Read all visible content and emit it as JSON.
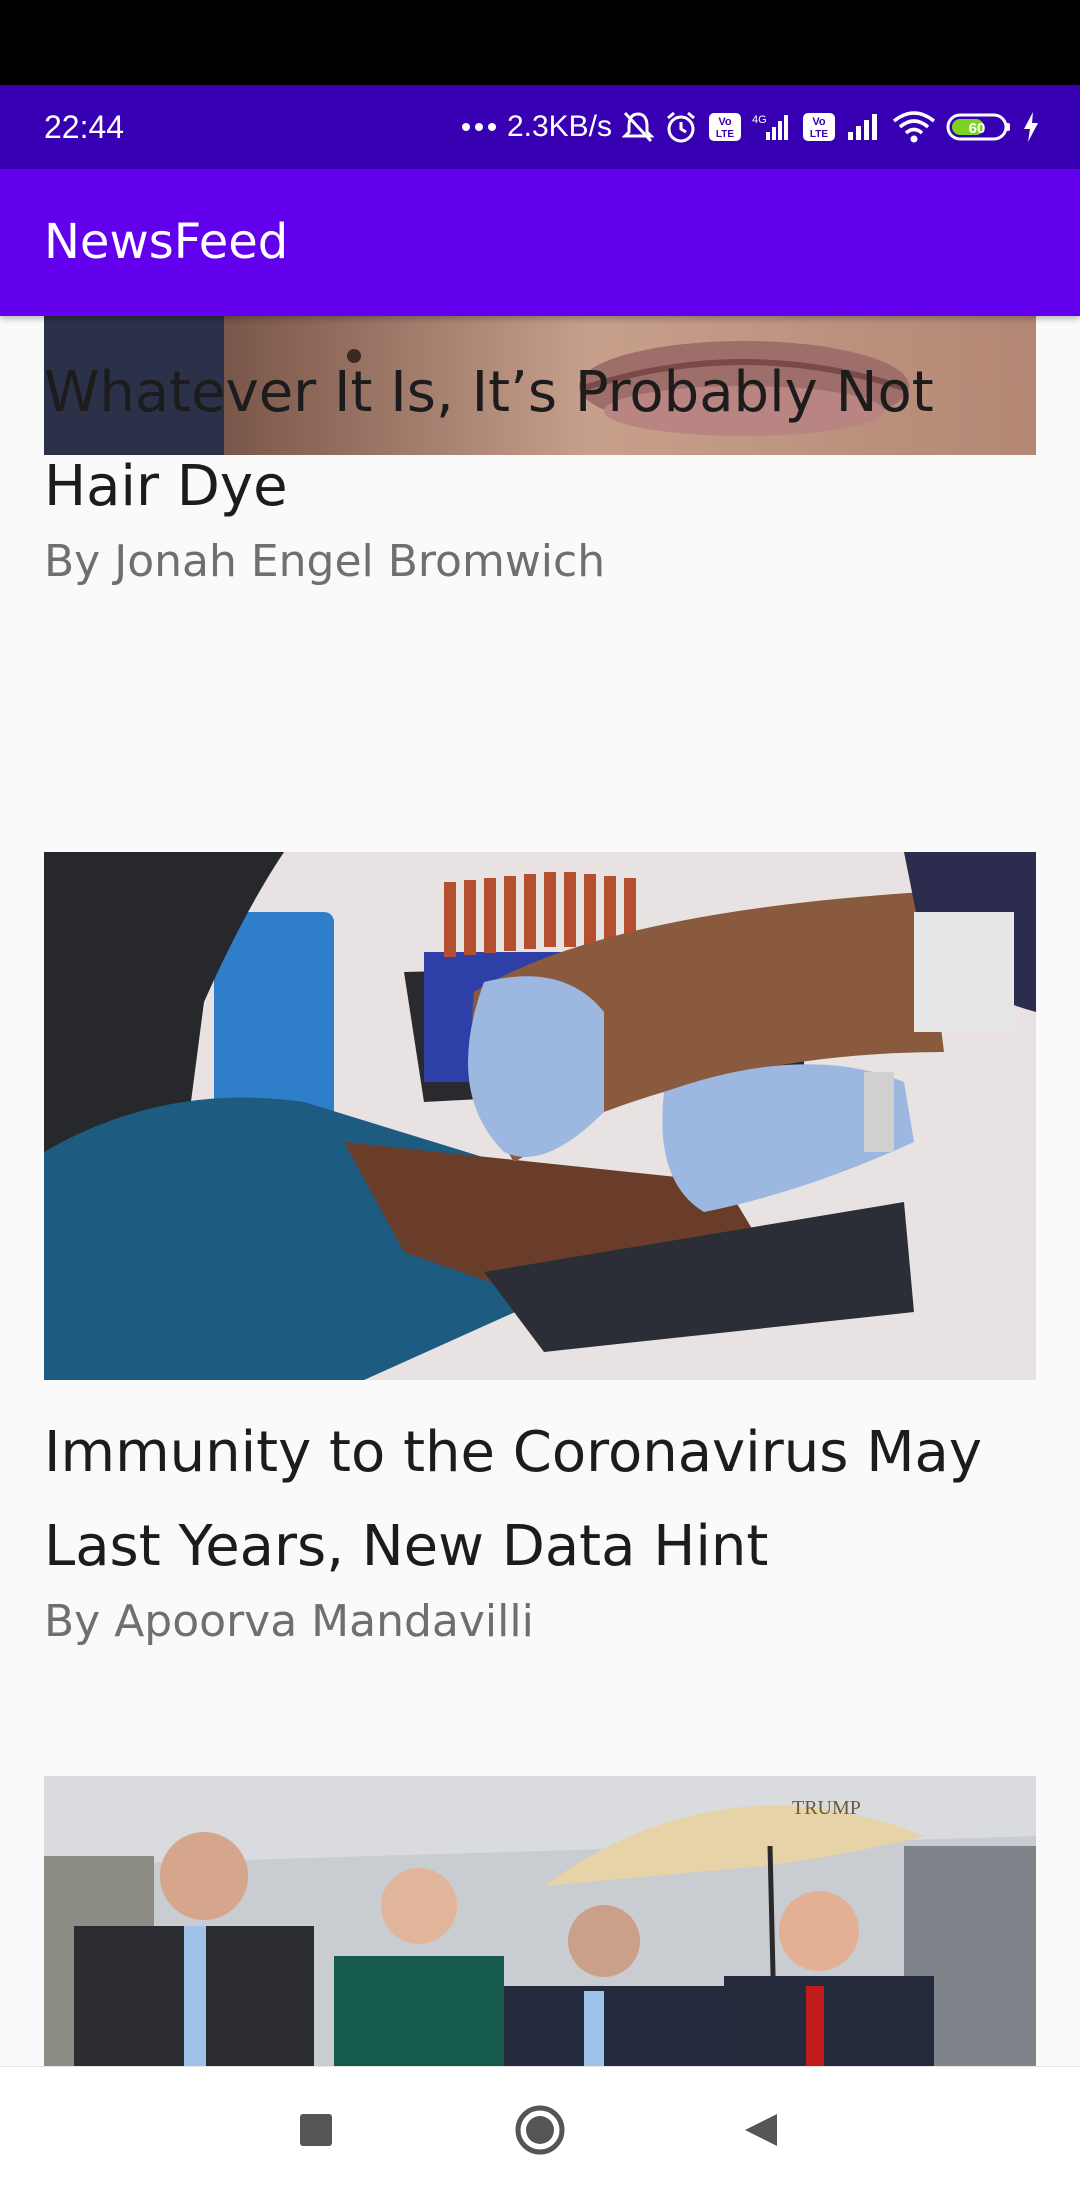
{
  "status_bar": {
    "time": "22:44",
    "net_speed": "2.3KB/s",
    "icons": [
      "mute-icon",
      "alarm-icon",
      "volte-icon",
      "4g-signal-icon",
      "volte-icon",
      "signal-icon",
      "wifi-icon",
      "battery-icon",
      "charging-icon"
    ],
    "battery_label": "60",
    "lte_label": "Vo LTE",
    "network_label": "4G"
  },
  "app_bar": {
    "title": "NewsFeed",
    "color": "#6200ee",
    "status_color": "#3700b3"
  },
  "articles": [
    {
      "title": "Whatever It Is, It’s Probably Not Hair Dye",
      "byline": "By Jonah Engel Bromwich",
      "image": "close-up-face-photo"
    },
    {
      "title": "Immunity to the Coronavirus May Last Years, New Data Hint",
      "byline": "By Apoorva Mandavilli",
      "image": "blood-draw-photo"
    },
    {
      "title": "",
      "byline": "",
      "image": "group-under-umbrella-photo",
      "umbrella_text": "TRUMP"
    }
  ],
  "nav_bar": {
    "buttons": [
      "recents-icon",
      "home-icon",
      "back-icon"
    ]
  }
}
